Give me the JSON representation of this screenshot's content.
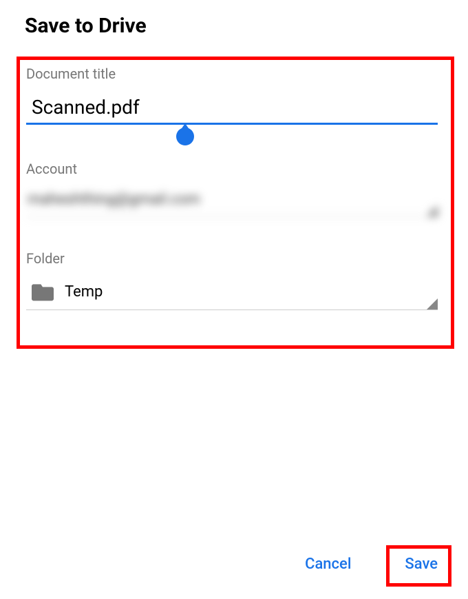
{
  "header": {
    "title": "Save to Drive"
  },
  "form": {
    "title_label": "Document title",
    "title_value": "Scanned.pdf",
    "account_label": "Account",
    "account_value": "maheshthing@gmail.com",
    "folder_label": "Folder",
    "folder_value": "Temp"
  },
  "actions": {
    "cancel": "Cancel",
    "save": "Save"
  },
  "colors": {
    "accent": "#1a73e8",
    "highlight": "#ff0000"
  }
}
